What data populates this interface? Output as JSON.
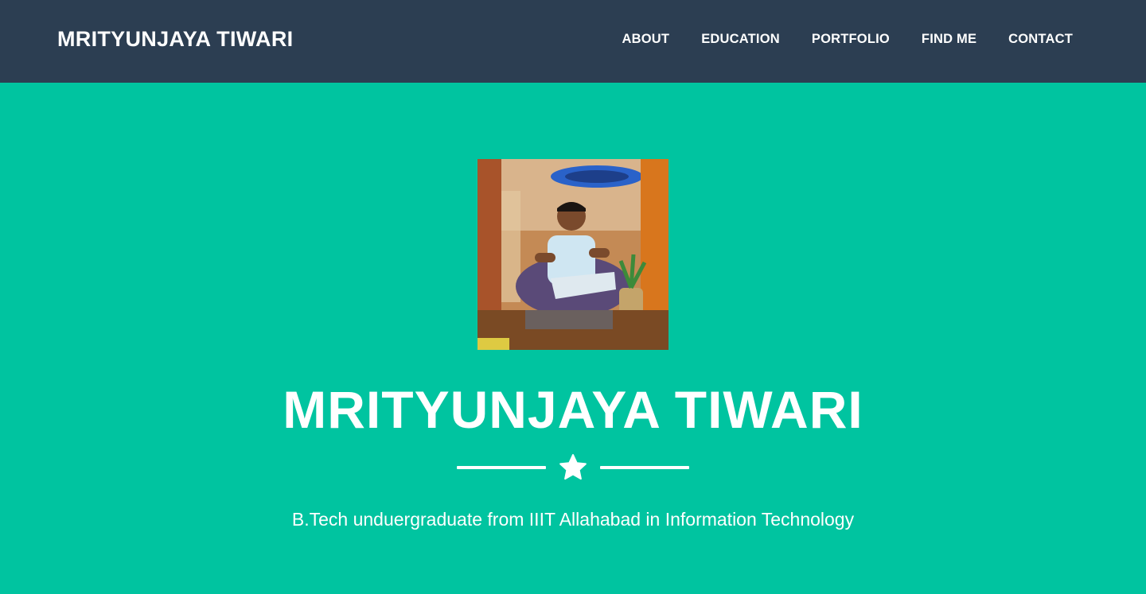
{
  "navbar": {
    "brand": "MRITYUNJAYA TIWARI",
    "links": [
      "ABOUT",
      "EDUCATION",
      "PORTFOLIO",
      "FIND ME",
      "CONTACT"
    ]
  },
  "hero": {
    "title": "MRITYUNJAYA TIWARI",
    "divider_icon": "star-icon",
    "subtitle": "B.Tech unduergraduate from IIIT Allahabad in Information Technology"
  },
  "colors": {
    "navbar_bg": "#2c3e52",
    "hero_bg": "#00c4a0",
    "text": "#ffffff"
  }
}
